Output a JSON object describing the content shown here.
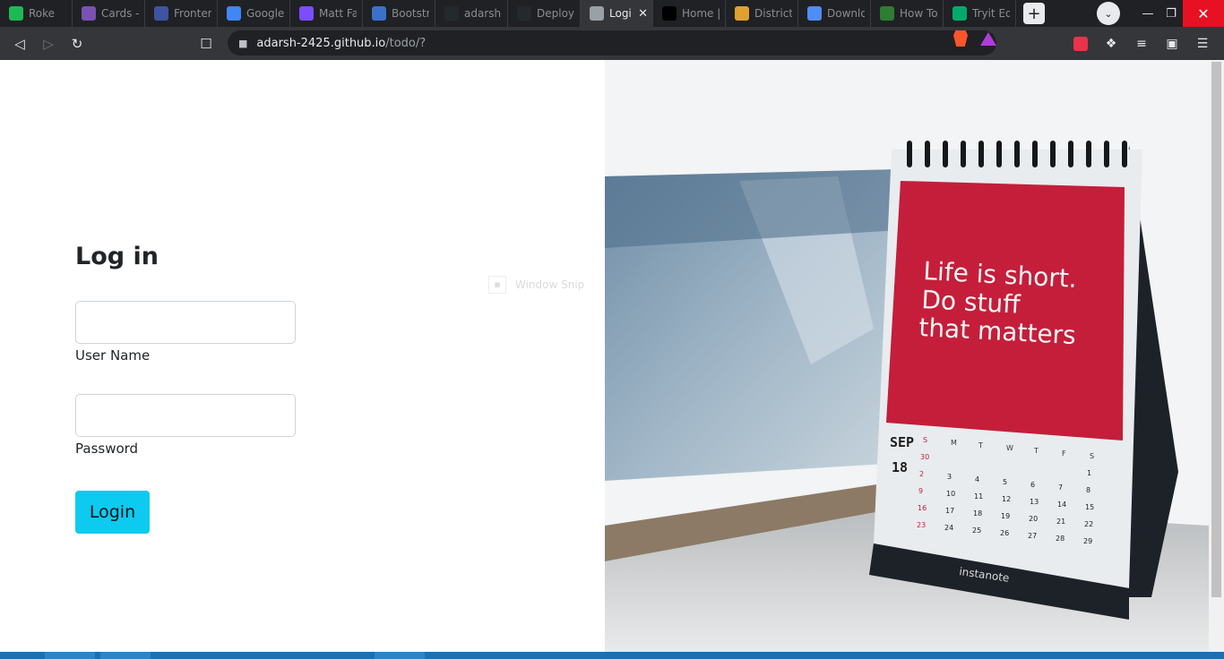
{
  "browser": {
    "tabs": [
      {
        "title": "Roke",
        "icon": "spotify-icon",
        "color": "#1db954"
      },
      {
        "title": "Cards - B",
        "icon": "bootstrap-icon",
        "color": "#7952b3"
      },
      {
        "title": "Fronten",
        "icon": "frontend-mentor-icon",
        "color": "#3e54a3"
      },
      {
        "title": "Google",
        "icon": "google-icon",
        "color": "#4285f4"
      },
      {
        "title": "Matt Fa",
        "icon": "chart-icon",
        "color": "#7c4dff"
      },
      {
        "title": "Bootstra",
        "icon": "mdb-icon",
        "color": "#3b71ca"
      },
      {
        "title": "adarsh-",
        "icon": "github-icon",
        "color": "#24292e"
      },
      {
        "title": "Deploy",
        "icon": "github-icon",
        "color": "#24292e"
      },
      {
        "title": "Logi",
        "icon": "globe-icon",
        "color": "#9aa0a6",
        "active": true
      },
      {
        "title": "Home |",
        "icon": "wix-icon",
        "color": "#000000"
      },
      {
        "title": "Districts",
        "icon": "districts-icon",
        "color": "#e0a030"
      },
      {
        "title": "Downlo",
        "icon": "diamond-icon",
        "color": "#4f8ef7"
      },
      {
        "title": "How To",
        "icon": "w-icon",
        "color": "#2e7d32"
      },
      {
        "title": "Tryit Edi",
        "icon": "w3-icon",
        "color": "#04aa6d"
      }
    ],
    "new_tab_label": "+",
    "url_host": "adarsh-2425.github.io",
    "url_path": "/todo/?"
  },
  "page": {
    "heading": "Log in",
    "username_label": "User Name",
    "username_value": "",
    "password_label": "Password",
    "password_value": "",
    "login_button": "Login",
    "snip_text": "Window Snip"
  },
  "photo": {
    "calendar_quote": [
      "Life is short.",
      "Do stuff",
      "that matters"
    ],
    "calendar_month": "SEP",
    "calendar_year": "18",
    "calendar_brand": "instanote",
    "weekday_heads": [
      "S",
      "M",
      "T",
      "W",
      "T",
      "F",
      "S"
    ],
    "weeks": [
      [
        "30",
        "",
        "",
        "",
        "",
        "",
        "1"
      ],
      [
        "2",
        "3",
        "4",
        "5",
        "6",
        "7",
        "8"
      ],
      [
        "9",
        "10",
        "11",
        "12",
        "13",
        "14",
        "15"
      ],
      [
        "16",
        "17",
        "18",
        "19",
        "20",
        "21",
        "22"
      ],
      [
        "23",
        "24",
        "25",
        "26",
        "27",
        "28",
        "29"
      ]
    ],
    "accent_color": "#c41e3a"
  }
}
